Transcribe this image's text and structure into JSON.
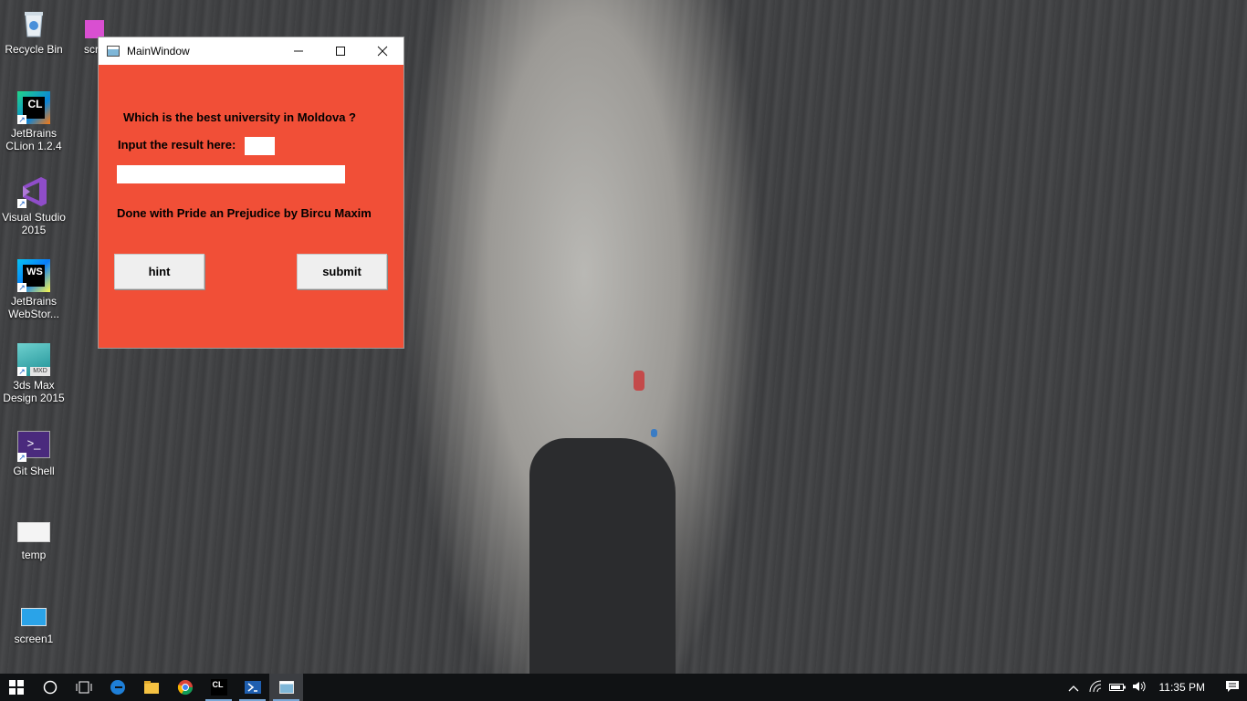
{
  "desktop": {
    "icons": [
      {
        "label": "Recycle Bin",
        "icon": "recycle-bin-icon"
      },
      {
        "label": "scr",
        "icon": "folder-icon"
      },
      {
        "label": "JetBrains CLion 1.2.4",
        "icon": "clion-icon",
        "badge": "CL"
      },
      {
        "label": "Visual Studio 2015",
        "icon": "visual-studio-icon"
      },
      {
        "label": "JetBrains WebStor...",
        "icon": "webstorm-icon",
        "badge": "WS"
      },
      {
        "label": "3ds Max Design 2015",
        "icon": "3ds-max-icon",
        "badge": "MXD"
      },
      {
        "label": "Git Shell",
        "icon": "git-shell-icon",
        "badge": ">_"
      },
      {
        "label": "temp",
        "icon": "image-file-icon"
      },
      {
        "label": "screen1",
        "icon": "image-file-icon"
      }
    ]
  },
  "window": {
    "title": "MainWindow",
    "question": "Which is the best university in Moldova ?",
    "input_label": "Input the result here:",
    "small_input_value": "",
    "wide_input_value": "",
    "credit": "Done with Pride an Prejudice by Bircu Maxim",
    "hint_label": "hint",
    "submit_label": "submit",
    "background_color": "#f14f37"
  },
  "taskbar": {
    "clock": "11:35 PM",
    "items": [
      "start-icon",
      "cortana-icon",
      "task-view-icon",
      "edge-icon",
      "file-explorer-icon",
      "chrome-icon",
      "clion-icon",
      "powershell-icon",
      "mainwindow-app-icon"
    ],
    "clion_badge": "CL"
  }
}
